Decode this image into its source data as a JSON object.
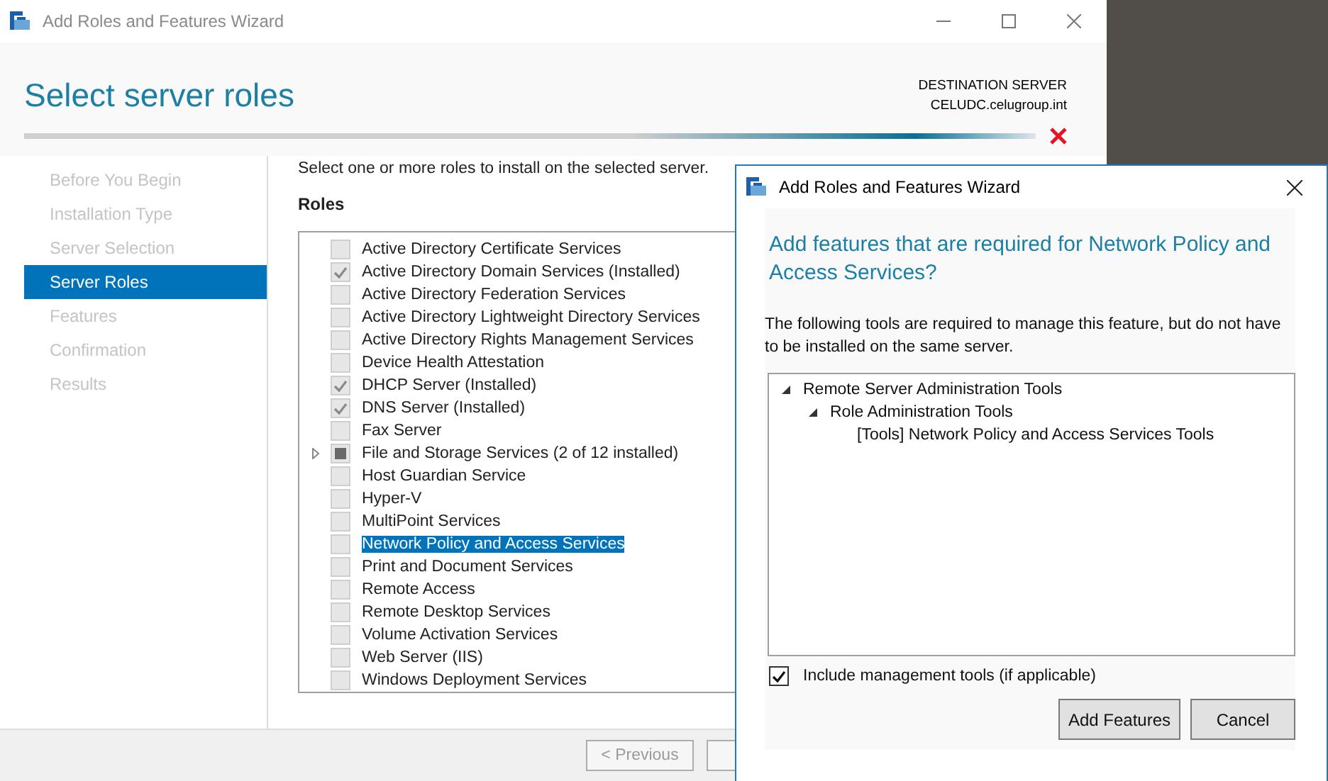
{
  "window": {
    "title": "Add Roles and Features Wizard"
  },
  "header": {
    "title": "Select server roles",
    "destination_label": "DESTINATION SERVER",
    "destination_server": "CELUDC.celugroup.int"
  },
  "sidebar": {
    "items": [
      {
        "label": "Before You Begin",
        "selected": false
      },
      {
        "label": "Installation Type",
        "selected": false
      },
      {
        "label": "Server Selection",
        "selected": false
      },
      {
        "label": "Server Roles",
        "selected": true
      },
      {
        "label": "Features",
        "selected": false
      },
      {
        "label": "Confirmation",
        "selected": false
      },
      {
        "label": "Results",
        "selected": false
      }
    ]
  },
  "content": {
    "instruction": "Select one or more roles to install on the selected server.",
    "roles_heading": "Roles"
  },
  "roles": [
    {
      "label": "Active Directory Certificate Services",
      "checked": false,
      "partial": false,
      "expandable": false,
      "selected": false
    },
    {
      "label": "Active Directory Domain Services (Installed)",
      "checked": true,
      "partial": false,
      "expandable": false,
      "selected": false
    },
    {
      "label": "Active Directory Federation Services",
      "checked": false,
      "partial": false,
      "expandable": false,
      "selected": false
    },
    {
      "label": "Active Directory Lightweight Directory Services",
      "checked": false,
      "partial": false,
      "expandable": false,
      "selected": false
    },
    {
      "label": "Active Directory Rights Management Services",
      "checked": false,
      "partial": false,
      "expandable": false,
      "selected": false
    },
    {
      "label": "Device Health Attestation",
      "checked": false,
      "partial": false,
      "expandable": false,
      "selected": false
    },
    {
      "label": "DHCP Server (Installed)",
      "checked": true,
      "partial": false,
      "expandable": false,
      "selected": false
    },
    {
      "label": "DNS Server (Installed)",
      "checked": true,
      "partial": false,
      "expandable": false,
      "selected": false
    },
    {
      "label": "Fax Server",
      "checked": false,
      "partial": false,
      "expandable": false,
      "selected": false
    },
    {
      "label": "File and Storage Services (2 of 12 installed)",
      "checked": false,
      "partial": true,
      "expandable": true,
      "selected": false
    },
    {
      "label": "Host Guardian Service",
      "checked": false,
      "partial": false,
      "expandable": false,
      "selected": false
    },
    {
      "label": "Hyper-V",
      "checked": false,
      "partial": false,
      "expandable": false,
      "selected": false
    },
    {
      "label": "MultiPoint Services",
      "checked": false,
      "partial": false,
      "expandable": false,
      "selected": false
    },
    {
      "label": "Network Policy and Access Services",
      "checked": false,
      "partial": false,
      "expandable": false,
      "selected": true
    },
    {
      "label": "Print and Document Services",
      "checked": false,
      "partial": false,
      "expandable": false,
      "selected": false
    },
    {
      "label": "Remote Access",
      "checked": false,
      "partial": false,
      "expandable": false,
      "selected": false
    },
    {
      "label": "Remote Desktop Services",
      "checked": false,
      "partial": false,
      "expandable": false,
      "selected": false
    },
    {
      "label": "Volume Activation Services",
      "checked": false,
      "partial": false,
      "expandable": false,
      "selected": false
    },
    {
      "label": "Web Server (IIS)",
      "checked": false,
      "partial": false,
      "expandable": false,
      "selected": false
    },
    {
      "label": "Windows Deployment Services",
      "checked": false,
      "partial": false,
      "expandable": false,
      "selected": false
    }
  ],
  "footer": {
    "previous_button": "< Previous"
  },
  "dialog": {
    "title": "Add Roles and Features Wizard",
    "heading": "Add features that are required for Network Policy and Access Services?",
    "description": "The following tools are required to manage this feature, but do not have to be installed on the same server.",
    "tree": [
      {
        "label": "Remote Server Administration Tools",
        "expanded": true,
        "children": [
          {
            "label": "Role Administration Tools",
            "expanded": true,
            "children": [
              {
                "label": "[Tools] Network Policy and Access Services Tools"
              }
            ]
          }
        ]
      }
    ],
    "include_tools": {
      "label": "Include management tools (if applicable)",
      "checked": true
    },
    "buttons": [
      "Add Features",
      "Cancel"
    ]
  }
}
